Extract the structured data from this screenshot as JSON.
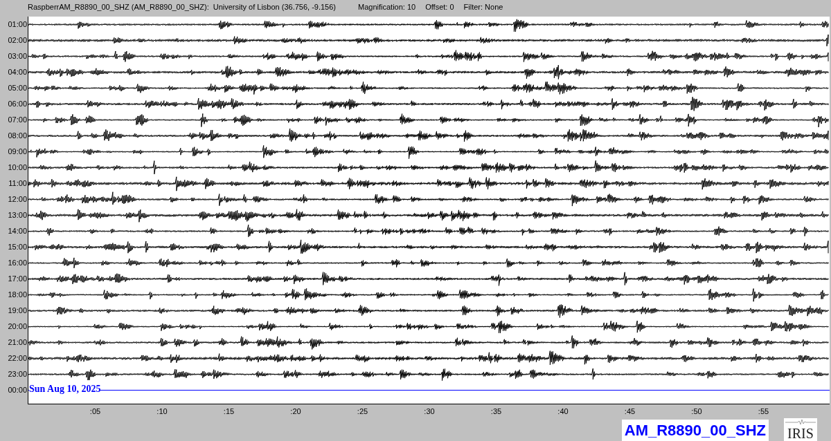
{
  "header": {
    "title": "RaspberrAM_R8890_00_SHZ (AM_R8890_00_SHZ):",
    "location": "University of Lisbon (36.756, -9.156)",
    "magnification": "Magnification: 10",
    "offset": "Offset: 0",
    "filter": "Filter: None"
  },
  "rows": [
    {
      "time": "01:00",
      "kind": "trace"
    },
    {
      "time": "02:00",
      "kind": "trace"
    },
    {
      "time": "03:00",
      "kind": "trace"
    },
    {
      "time": "04:00",
      "kind": "trace"
    },
    {
      "time": "05:00",
      "kind": "trace"
    },
    {
      "time": "06:00",
      "kind": "trace"
    },
    {
      "time": "07:00",
      "kind": "trace"
    },
    {
      "time": "08:00",
      "kind": "trace"
    },
    {
      "time": "09:00",
      "kind": "trace"
    },
    {
      "time": "10:00",
      "kind": "trace"
    },
    {
      "time": "11:00",
      "kind": "trace"
    },
    {
      "time": "12:00",
      "kind": "trace"
    },
    {
      "time": "13:00",
      "kind": "trace"
    },
    {
      "time": "14:00",
      "kind": "trace"
    },
    {
      "time": "15:00",
      "kind": "trace"
    },
    {
      "time": "16:00",
      "kind": "trace"
    },
    {
      "time": "17:00",
      "kind": "trace"
    },
    {
      "time": "18:00",
      "kind": "trace"
    },
    {
      "time": "19:00",
      "kind": "trace"
    },
    {
      "time": "20:00",
      "kind": "trace"
    },
    {
      "time": "21:00",
      "kind": "trace"
    },
    {
      "time": "22:00",
      "kind": "trace"
    },
    {
      "time": "23:00",
      "kind": "trace"
    },
    {
      "time": "00:00",
      "kind": "current",
      "date": "Sun Aug 10, 2025"
    }
  ],
  "x_ticks": [
    ":05",
    ":10",
    ":15",
    ":20",
    ":25",
    ":30",
    ":35",
    ":40",
    ":45",
    ":50",
    ":55"
  ],
  "station_label": "AM_R8890_00_SHZ",
  "logo": "IRIS"
}
